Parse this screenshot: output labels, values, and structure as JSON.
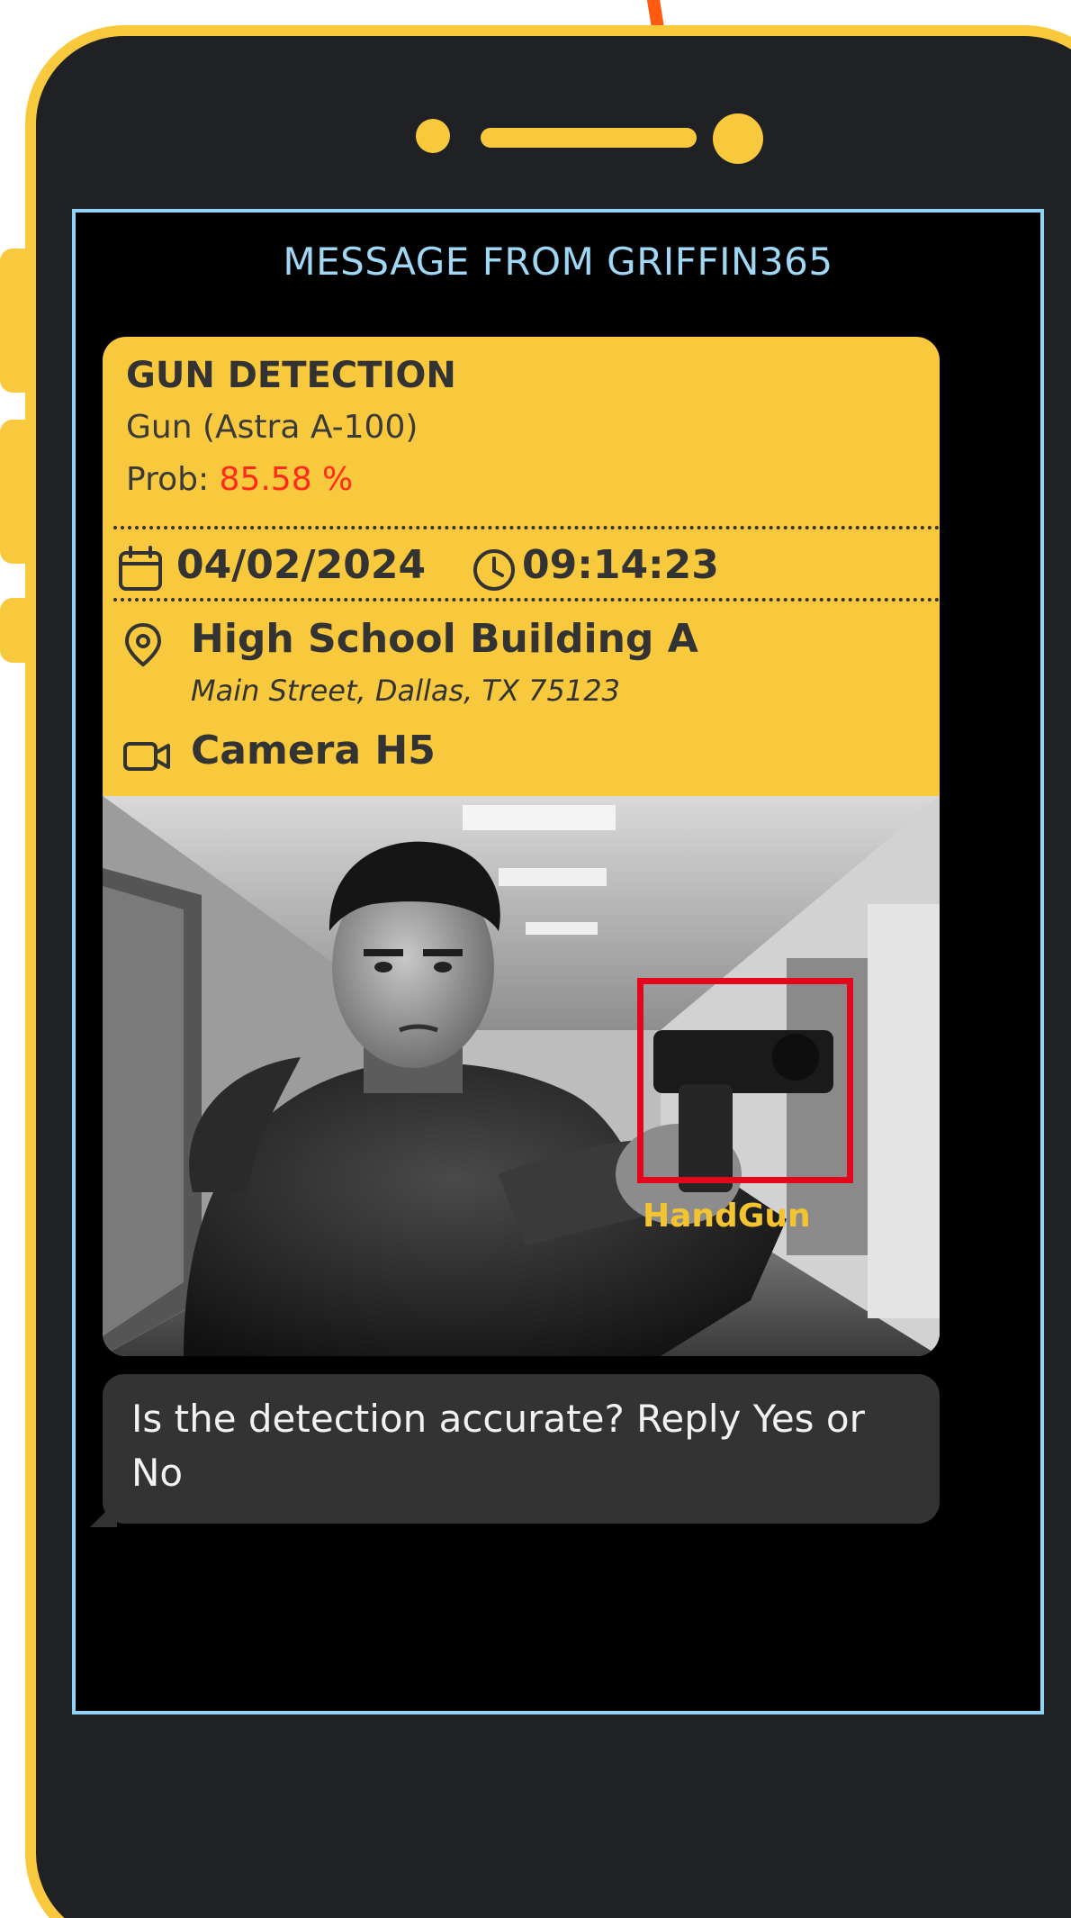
{
  "header": {
    "title": "MESSAGE FROM GRIFFIN365"
  },
  "card": {
    "title": "GUN DETECTION",
    "weapon": "Gun (Astra A-100)",
    "prob_label": "Prob:",
    "prob_value": "85.58 %",
    "date": "04/02/2024",
    "time": "09:14:23",
    "location_name": "High School Building A",
    "address": "Main Street, Dallas, TX 75123",
    "camera": "Camera H5"
  },
  "detection": {
    "label": "HandGun"
  },
  "reply": {
    "text": "Is the detection accurate? Reply Yes or No"
  },
  "icons": {
    "calendar": "calendar-icon",
    "clock": "clock-icon",
    "location": "location-pin-icon",
    "camera": "video-camera-icon",
    "arrow": "arrow-down-icon"
  },
  "colors": {
    "accent_yellow": "#f9c93d",
    "screen_border": "#8fd3f6",
    "probability": "#ff2a1a",
    "bounding_box": "#e4071c",
    "arrow": "#ff5a0e"
  }
}
